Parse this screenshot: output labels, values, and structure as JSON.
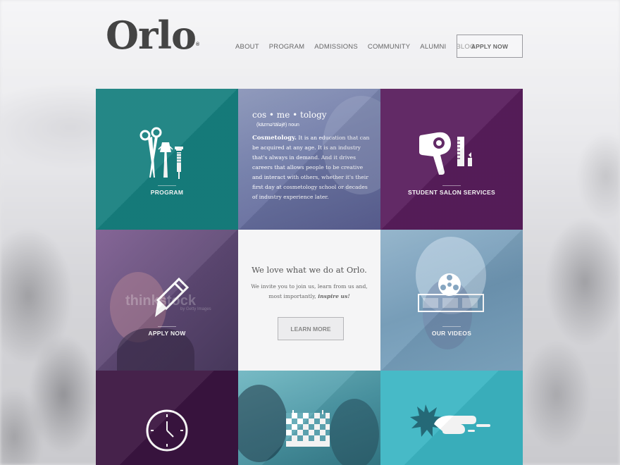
{
  "header": {
    "logo": "Orlo",
    "logo_mark": "®",
    "nav": [
      "ABOUT",
      "PROGRAM",
      "ADMISSIONS",
      "COMMUNITY",
      "ALUMNI",
      "BLOG"
    ],
    "apply_label": "APPLY NOW"
  },
  "tiles": {
    "program": {
      "label": "PROGRAM",
      "icon": "scissors-comb-brush-icon"
    },
    "definition": {
      "word": "cos • me • tology",
      "pronunciation": "(käzmə'täləjē) noun",
      "term": "Cosmetology.",
      "body": "It is an education that can be acquired at any age. It is an industry that's always in demand. And it drives careers that allows people to be creative and interact with others, whether it's their first day at cosmetology school or decades of industry experience later."
    },
    "salon": {
      "label": "STUDENT SALON SERVICES",
      "icon": "hair-dryer-icon"
    },
    "apply": {
      "label": "APPLY NOW",
      "icon": "pen-icon",
      "watermark_1": "thinkstock",
      "watermark_2": "by Getty Images"
    },
    "love": {
      "title": "We love what we do at Orlo.",
      "text_1": "We invite you to join us, learn from us and,",
      "text_2": "most importantly,",
      "text_emph": "inspire us!",
      "button": "LEARN MORE"
    },
    "videos": {
      "label": "OUR VIDEOS",
      "icon": "film-reel-icon"
    },
    "clock": {
      "icon": "clock-icon"
    },
    "calendar": {
      "icon": "calendar-icon"
    },
    "splash": {
      "icon": "splash-icon"
    }
  },
  "colors": {
    "teal": "#16807f",
    "purple": "#581d5c",
    "dark_purple": "#3a1440",
    "aqua": "#3cb6c4"
  }
}
